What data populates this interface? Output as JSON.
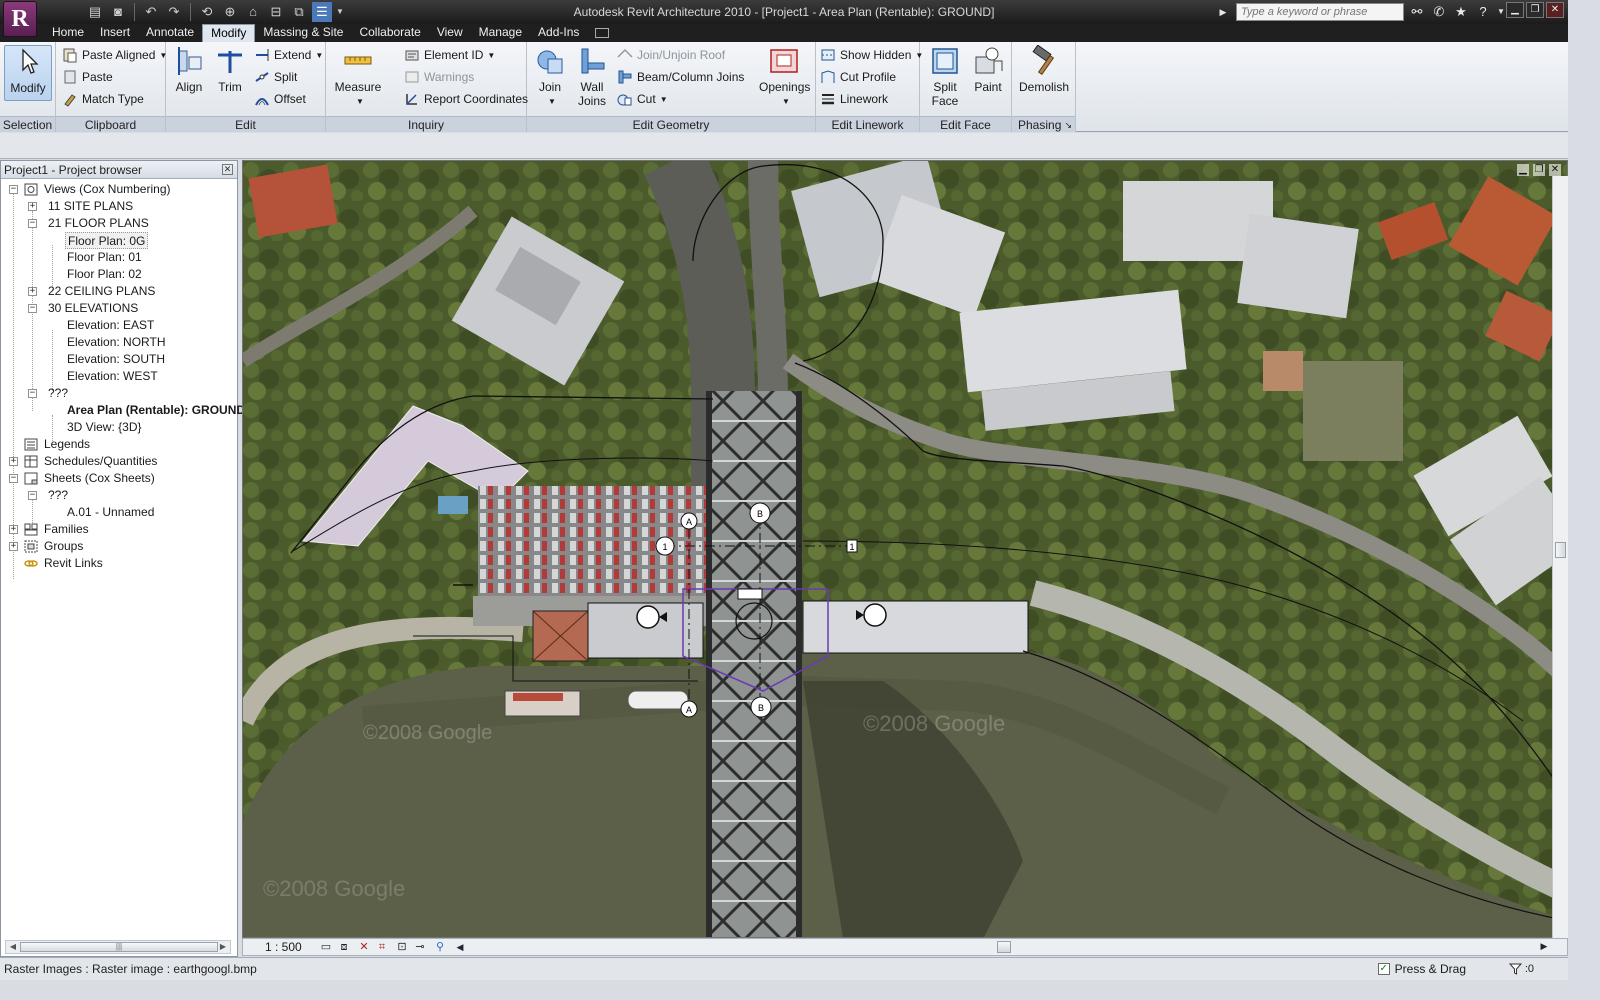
{
  "app": {
    "window_title": "Autodesk Revit Architecture 2010 - [Project1 - Area Plan (Rentable): GROUND]",
    "app_button_letter": "R",
    "search_placeholder": "Type a keyword or phrase"
  },
  "tabs": [
    {
      "label": "Home",
      "active": false
    },
    {
      "label": "Insert",
      "active": false
    },
    {
      "label": "Annotate",
      "active": false
    },
    {
      "label": "Modify",
      "active": true
    },
    {
      "label": "Massing & Site",
      "active": false
    },
    {
      "label": "Collaborate",
      "active": false
    },
    {
      "label": "View",
      "active": false
    },
    {
      "label": "Manage",
      "active": false
    },
    {
      "label": "Add-Ins",
      "active": false
    }
  ],
  "ribbon": {
    "selection": {
      "title": "Selection",
      "modify": "Modify"
    },
    "clipboard": {
      "title": "Clipboard",
      "paste_aligned": "Paste Aligned",
      "paste": "Paste",
      "match_type": "Match Type"
    },
    "edit": {
      "title": "Edit",
      "align": "Align",
      "trim": "Trim",
      "extend": "Extend",
      "split": "Split",
      "offset": "Offset"
    },
    "inquiry": {
      "title": "Inquiry",
      "measure": "Measure",
      "element_id": "Element ID",
      "warnings": "Warnings",
      "report_coordinates": "Report Coordinates"
    },
    "edit_geometry": {
      "title": "Edit Geometry",
      "join": "Join",
      "wall_joins": "Wall Joins",
      "join_unjoin_roof": "Join/Unjoin Roof",
      "beam_column_joins": "Beam/Column Joins",
      "cut": "Cut",
      "openings": "Openings"
    },
    "edit_linework": {
      "title": "Edit Linework",
      "show_hidden": "Show Hidden",
      "cut_profile": "Cut Profile",
      "linework": "Linework"
    },
    "edit_face": {
      "title": "Edit Face",
      "split_face": "Split Face",
      "paint": "Paint"
    },
    "phasing": {
      "title": "Phasing",
      "demolish": "Demolish"
    }
  },
  "browser": {
    "title": "Project1 - Project browser",
    "nodes": {
      "views": "Views (Cox Numbering)",
      "site_plans": "11 SITE PLANS",
      "floor_plans": "21 FLOOR PLANS",
      "fp_0g": "Floor Plan: 0G",
      "fp_01": "Floor Plan: 01",
      "fp_02": "Floor Plan: 02",
      "ceiling_plans": "22 CEILING PLANS",
      "elevations": "30 ELEVATIONS",
      "el_east": "Elevation: EAST",
      "el_north": "Elevation: NORTH",
      "el_south": "Elevation: SOUTH",
      "el_west": "Elevation: WEST",
      "unknown_group": "???",
      "area_plan": "Area Plan (Rentable): GROUND",
      "view_3d": "3D View: {3D}",
      "legends": "Legends",
      "schedules": "Schedules/Quantities",
      "sheets": "Sheets (Cox Sheets)",
      "sheets_unknown": "???",
      "sheet_a01": "A.01 - Unnamed",
      "families": "Families",
      "groups": "Groups",
      "revit_links": "Revit Links"
    }
  },
  "viewbar": {
    "scale": "1 : 500"
  },
  "status": {
    "text": "Raster Images : Raster image : earthgoogl.bmp",
    "press_drag": "Press & Drag",
    "press_drag_checked": true,
    "filter_count": ":0"
  },
  "drawing": {
    "grid_bubbles": [
      "A",
      "1",
      "B",
      "1",
      "A",
      "B"
    ],
    "watermarks": [
      "©2008 Google",
      "©2008 Google",
      "©2008 Google"
    ]
  },
  "colors": {
    "active_tab": "#dfe6ef",
    "title_bar": "#1b1b1b",
    "river": "#5d6049",
    "area_boundary": "#6a3ab5"
  }
}
